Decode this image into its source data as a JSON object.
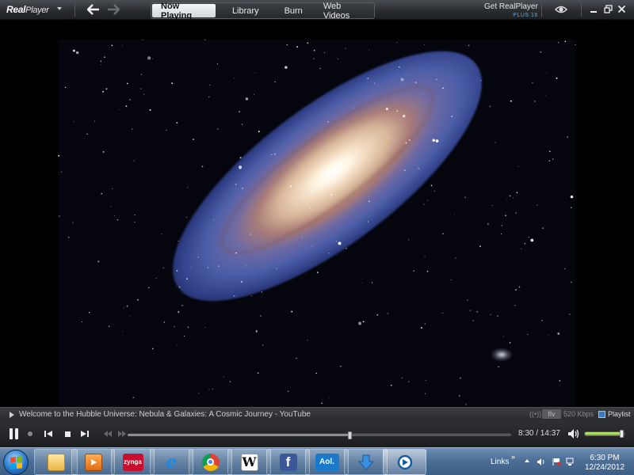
{
  "app": {
    "logo_real": "Real",
    "logo_player": "Player",
    "get_realplayer": "Get RealPlayer",
    "get_realplayer_sub": "PLUS 16"
  },
  "tabs": [
    {
      "label": "Now Playing",
      "active": true
    },
    {
      "label": "Library",
      "active": false
    },
    {
      "label": "Burn",
      "active": false
    },
    {
      "label": "Web Videos",
      "active": false
    }
  ],
  "now_playing": {
    "title": "Welcome to the Hubble Universe: Nebula & Galaxies: A Cosmic Journey - YouTube",
    "signal": "((•))",
    "format": "flv",
    "bitrate": "520 Kbps",
    "playlist_label": "Playlist"
  },
  "playback": {
    "elapsed": "8:30",
    "duration": "14:37",
    "time_display": "8:30 / 14:37",
    "progress_fraction": 0.58,
    "volume_fraction": 0.9,
    "state": "playing"
  },
  "taskbar": {
    "pinned": [
      {
        "name": "explorer",
        "icon": "folder-icon"
      },
      {
        "name": "media-player",
        "icon": "media-player-icon"
      },
      {
        "name": "zynga",
        "icon": "zynga-icon",
        "label": "zynga"
      },
      {
        "name": "internet-explorer",
        "icon": "ie-icon"
      },
      {
        "name": "chrome",
        "icon": "chrome-icon"
      },
      {
        "name": "wikipedia",
        "icon": "wikipedia-icon",
        "label": "W"
      },
      {
        "name": "facebook",
        "icon": "facebook-icon",
        "label": "f"
      },
      {
        "name": "aol",
        "icon": "aol-icon",
        "label": "Aol."
      },
      {
        "name": "downloader",
        "icon": "download-icon"
      },
      {
        "name": "realplayer",
        "icon": "realplayer-icon"
      }
    ],
    "links_label": "Links",
    "links_chevron": "»",
    "clock_time": "6:30 PM",
    "clock_date": "12/24/2012"
  },
  "colors": {
    "titlebar": "#2a2c30",
    "active_tab": "#e8ecf0",
    "volume_fill": "#9fd84a",
    "taskbar": "#4d6f96"
  }
}
